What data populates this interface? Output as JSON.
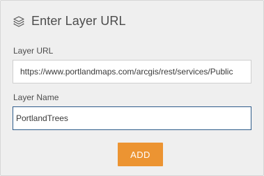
{
  "panel": {
    "title": "Enter Layer URL",
    "icon": "layers-icon"
  },
  "layer_url": {
    "label": "Layer URL",
    "value": "https://www.portlandmaps.com/arcgis/rest/services/Public"
  },
  "layer_name": {
    "label": "Layer Name",
    "value": "PortlandTrees"
  },
  "add_button": {
    "label": "ADD",
    "color": "#ec9432"
  }
}
